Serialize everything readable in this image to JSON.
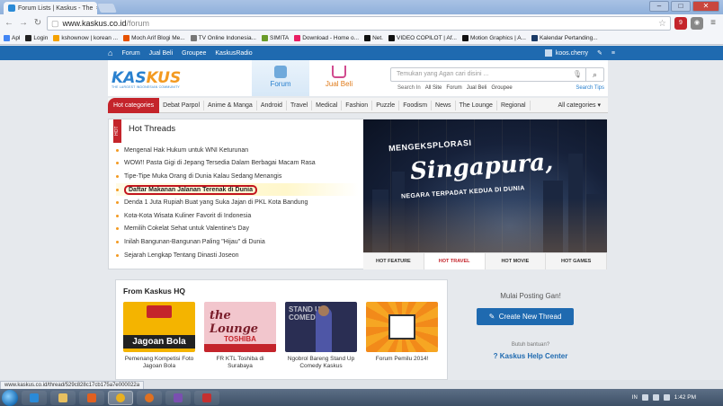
{
  "browser": {
    "tab_title": "Forum Lists | Kaskus - The",
    "tab_close": "×",
    "url_host": "www.kaskus.co.id",
    "url_path": "/forum",
    "window_buttons": [
      "–",
      "□",
      "✕"
    ],
    "bookmarks": [
      {
        "label": "Apl",
        "color": "#4285f4"
      },
      {
        "label": "Login",
        "color": "#222222"
      },
      {
        "label": "kshownow | korean ...",
        "color": "#f4a100"
      },
      {
        "label": "Moch Arif Blogi Me...",
        "color": "#e65100"
      },
      {
        "label": "TV Online Indonesia...",
        "color": "#777777"
      },
      {
        "label": "SIMITA",
        "color": "#6a9b2a"
      },
      {
        "label": "Download - Home o...",
        "color": "#e91e63"
      },
      {
        "label": "Net.",
        "color": "#111111"
      },
      {
        "label": "VIDEO COPILOT | Af...",
        "color": "#111111"
      },
      {
        "label": "Motion Graphics | A...",
        "color": "#111111"
      },
      {
        "label": "Kalendar Pertanding...",
        "color": "#1a3a66"
      }
    ],
    "status_url": "www.kaskus.co.id/thread/529c828c17cb175a7e000022a"
  },
  "site": {
    "nav": {
      "home_icon": "⌂",
      "links": [
        "Forum",
        "Jual Beli",
        "Groupee",
        "KaskusRadio"
      ],
      "user": "koos.cherry",
      "edit_icon": "✎",
      "menu_icon": "≡"
    },
    "logo": {
      "word_a": "KAS",
      "word_b": "KUS",
      "tagline": "THE LARGEST INDONESIAN COMMUNITY"
    },
    "tabs": {
      "forum": "Forum",
      "jualbeli": "Jual Beli"
    },
    "search": {
      "placeholder": "Temukan yang Agan cari disini ...",
      "search_in_label": "Search In",
      "options": [
        "All Site",
        "Forum",
        "Jual Beli",
        "Groupee"
      ],
      "tips": "Search Tips"
    },
    "categories": {
      "hot": "Hot categories",
      "items": [
        "Debat Parpol",
        "Anime & Manga",
        "Android",
        "Travel",
        "Medical",
        "Fashion",
        "Puzzle",
        "Foodism",
        "News",
        "The Lounge",
        "Regional"
      ],
      "all": "All categories",
      "all_arrow": "▾"
    },
    "hot_threads": {
      "side_label": "HOT",
      "title": "Hot Threads",
      "items": [
        "Mengenal Hak Hukum untuk WNI Keturunan",
        "WOW!! Pasta Gigi di Jepang Tersedia Dalam Berbagai Macam Rasa",
        "Tipe-Tipe Muka Orang di Dunia Kalau Sedang Menangis",
        "Daftar Makanan Jalanan Terenak di Dunia",
        "Denda 1 Juta Rupiah Buat yang Suka Jajan di PKL Kota Bandung",
        "Kota-Kota Wisata Kuliner Favorit di Indonesia",
        "Memilih Cokelat Sehat untuk Valentine's Day",
        "Inilah Bangunan-Bangunan Paling \"Hijau\" di Dunia",
        "Sejarah Lengkap Tentang Dinasti Joseon"
      ],
      "active_index": 3
    },
    "banner": {
      "line1": "MENGEKSPLORASI",
      "line2": "Singapura,",
      "line3": "NEGARA TERPADAT KEDUA DI DUNIA",
      "tabs": [
        "HOT FEATURE",
        "HOT TRAVEL",
        "HOT MOVIE",
        "HOT GAMES"
      ],
      "active_tab": 1
    },
    "hq": {
      "title": "From Kaskus HQ",
      "cards": [
        {
          "caption": "Pemenang Kompetisi Foto Jagoan Bola",
          "img_text": "Jagoan Bola"
        },
        {
          "caption": "FR KTL Toshiba di Surabaya",
          "img_text": "the Lounge",
          "img_sub": "TOSHIBA"
        },
        {
          "caption": "Ngobrol Bareng Stand Up Comedy Kaskus",
          "img_text": "STAND UP COMEDY"
        },
        {
          "caption": "Forum Pemilu 2014!",
          "img_text": ""
        }
      ]
    },
    "side": {
      "mulai": "Mulai Posting Gan!",
      "create": "Create New Thread",
      "create_icon": "✎",
      "butuh": "Butuh bantuan?",
      "help": "Kaskus Help Center",
      "help_icon": "?"
    }
  },
  "taskbar": {
    "lang": "IN",
    "time": "1:42 PM"
  }
}
